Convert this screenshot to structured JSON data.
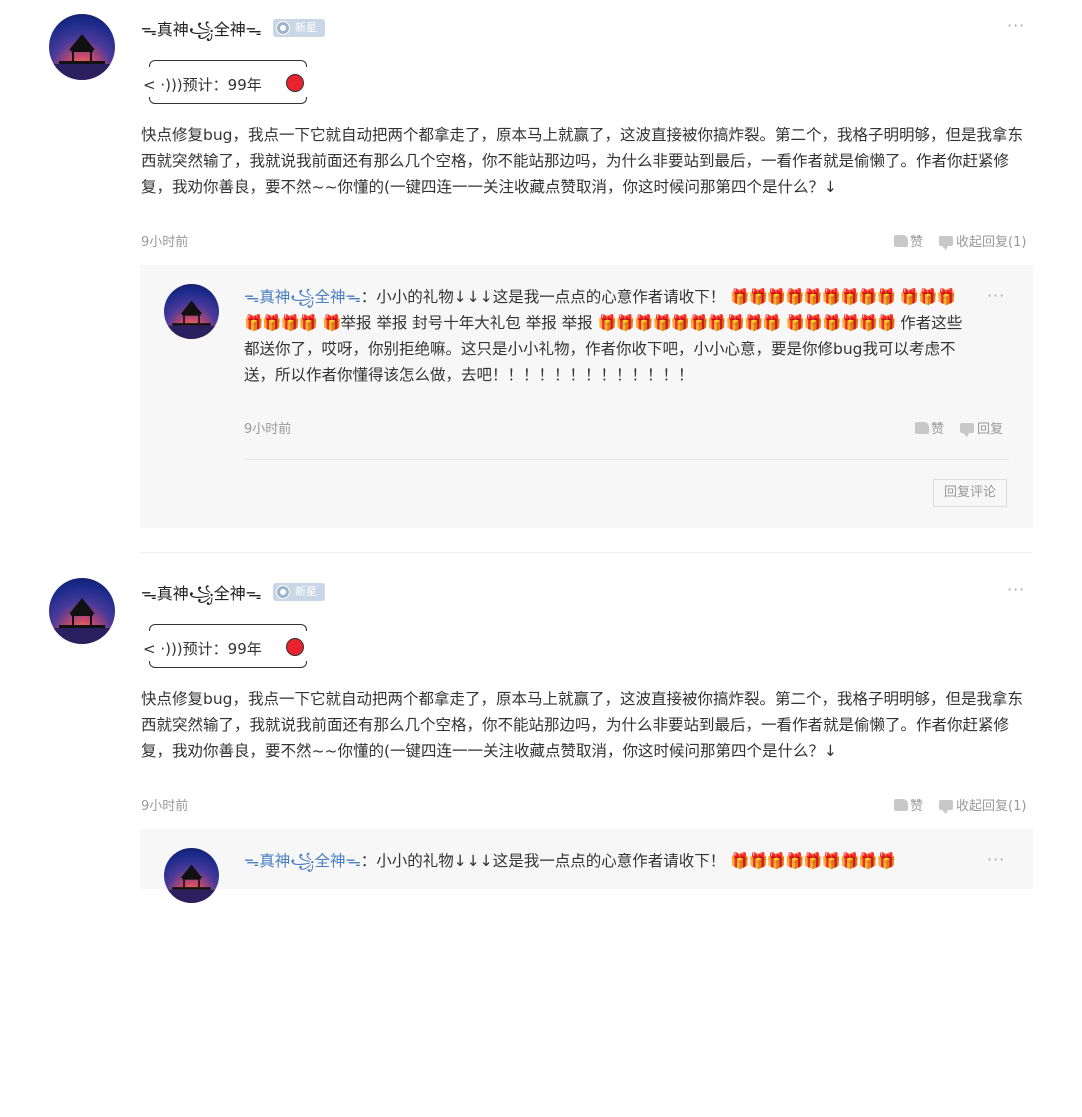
{
  "comments": [
    {
      "author": "ᯓ真神꧁全神ᯓ",
      "badge": "新星",
      "more": "···",
      "signature": "< ·)))预计：99年",
      "text": "快点修复bug，我点一下它就自动把两个都拿走了，原本马上就赢了，这波直接被你搞炸裂。第二个，我格子明明够，但是我拿东西就突然输了，我就说我前面还有那么几个空格，你不能站那边吗，为什么非要站到最后，一看作者就是偷懒了。作者你赶紧修复，我劝你善良，要不然~~你懂的(一键四连一一关注收藏点赞取消，你这时候问那第四个是什么？↓",
      "time": "9小时前",
      "like_label": "赞",
      "reply_toggle_label": "收起回复(1)",
      "reply": {
        "author": "ᯓ真神꧁全神ᯓ",
        "colon": "：",
        "text_1": "小小的礼物↓↓↓这是我一点点的心意作者请收下！",
        "gifts_1": "🎁🎁🎁🎁🎁🎁🎁🎁🎁",
        "gifts_2": "🎁🎁🎁🎁🎁🎁🎁",
        "text_2": "举报 举报 封号十年大礼包 举报 举报",
        "gifts_3": "🎁",
        "gifts_4": "🎁🎁🎁🎁🎁🎁🎁🎁🎁🎁",
        "gifts_5": "🎁🎁🎁🎁🎁🎁",
        "text_3": "作者这些都送你了，哎呀，你别拒绝嘛。这只是小小礼物，作者你收下吧，小小心意，要是你修bug我可以考虑不送，所以作者你懂得该怎么做，去吧！！！！！！！！！！！！！",
        "time": "9小时前",
        "like_label": "赞",
        "reply_label": "回复",
        "reply_comment_button": "回复评论"
      }
    }
  ]
}
